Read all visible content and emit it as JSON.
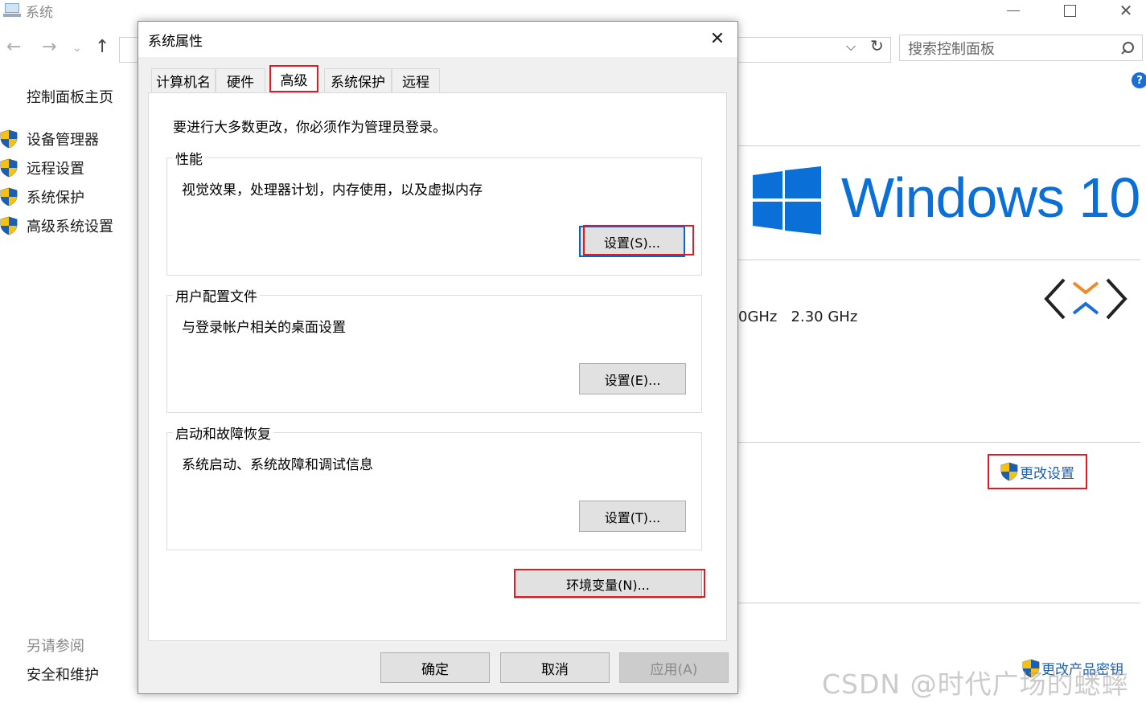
{
  "background_window": {
    "title": "系统",
    "search_placeholder": "搜索控制面板",
    "help_label": "?",
    "sidebar": {
      "home": "控制面板主页",
      "items": [
        {
          "label": "设备管理器",
          "icon": "uac-shield-icon"
        },
        {
          "label": "远程设置",
          "icon": "uac-shield-icon"
        },
        {
          "label": "系统保护",
          "icon": "uac-shield-icon"
        },
        {
          "label": "高级系统设置",
          "icon": "uac-shield-icon"
        }
      ],
      "see_also_heading": "另请参阅",
      "see_also_link": "安全和维护"
    },
    "content": {
      "windows_brand": "Windows 10",
      "processor_speed": "0GHz   2.30 GHz",
      "change_settings": "更改设置",
      "change_product_key": "更改产品密钥"
    },
    "watermark": "CSDN @时代广场的蟋蟀"
  },
  "dialog": {
    "title": "系统属性",
    "close_label": "✕",
    "tabs": [
      {
        "label": "计算机名",
        "active": false
      },
      {
        "label": "硬件",
        "active": false
      },
      {
        "label": "高级",
        "active": true
      },
      {
        "label": "系统保护",
        "active": false
      },
      {
        "label": "远程",
        "active": false
      }
    ],
    "intro": "要进行大多数更改，你必须作为管理员登录。",
    "groups": [
      {
        "title": "性能",
        "description": "视觉效果，处理器计划，内存使用，以及虚拟内存",
        "button": "设置(S)..."
      },
      {
        "title": "用户配置文件",
        "description": "与登录帐户相关的桌面设置",
        "button": "设置(E)..."
      },
      {
        "title": "启动和故障恢复",
        "description": "系统启动、系统故障和调试信息",
        "button": "设置(T)..."
      }
    ],
    "env_button": "环境变量(N)...",
    "footer": {
      "ok": "确定",
      "cancel": "取消",
      "apply": "应用(A)"
    }
  },
  "colors": {
    "highlight_red": "#e01b24",
    "windows_blue": "#0a6fd6",
    "link_blue": "#1a5fb4"
  }
}
